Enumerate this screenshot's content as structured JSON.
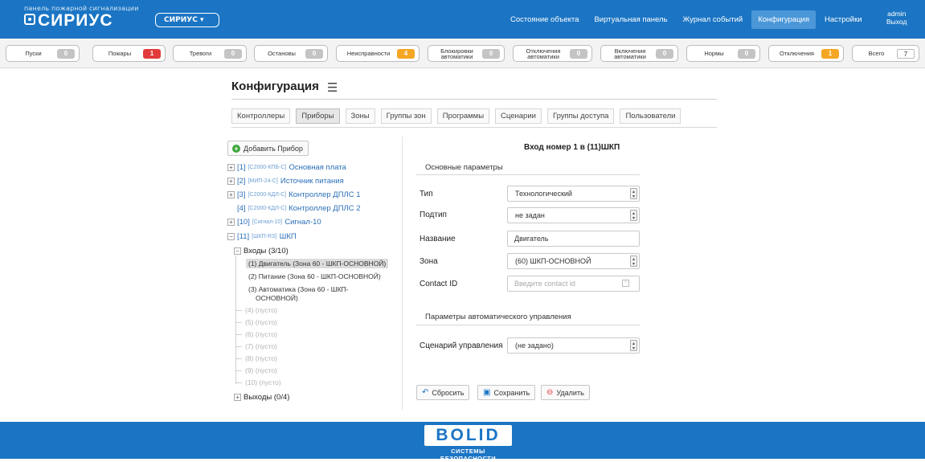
{
  "header": {
    "brand_subtitle": "панель пожарной сигнализации",
    "brand_name": "СИРИУС",
    "system_select": "СИРИУС",
    "nav": [
      {
        "label": "Состояние объекта"
      },
      {
        "label": "Виртуальная панель"
      },
      {
        "label": "Журнал событий"
      },
      {
        "label": "Конфигурация"
      },
      {
        "label": "Настройки"
      }
    ],
    "user": {
      "name": "admin",
      "logout": "Выход"
    }
  },
  "status_bar": [
    {
      "label": "Пуски",
      "count": "0"
    },
    {
      "label": "Пожары",
      "count": "1"
    },
    {
      "label": "Тревоги",
      "count": "0"
    },
    {
      "label": "Остановы",
      "count": "0"
    },
    {
      "label": "Неисправности",
      "count": "4"
    },
    {
      "label": "Блокировки автоматики",
      "count": "0"
    },
    {
      "label": "Отключения автоматики",
      "count": "0"
    },
    {
      "label": "Включения автоматики",
      "count": "0"
    },
    {
      "label": "Нормы",
      "count": "0"
    },
    {
      "label": "Отключения",
      "count": "1"
    },
    {
      "label": "Всего",
      "count": "7"
    }
  ],
  "page": {
    "title": "Конфигурация",
    "tabs": [
      {
        "label": "Контроллеры"
      },
      {
        "label": "Приборы"
      },
      {
        "label": "Зоны"
      },
      {
        "label": "Группы зон"
      },
      {
        "label": "Программы"
      },
      {
        "label": "Сценарии"
      },
      {
        "label": "Группы доступа"
      },
      {
        "label": "Пользователи"
      }
    ]
  },
  "tree": {
    "add_label": "Добавить Прибор",
    "devices": [
      {
        "num": "[1]",
        "code": "[С2000-КПБ-С]",
        "name": "Основная плата"
      },
      {
        "num": "[2]",
        "code": "[МИП-24-С]",
        "name": "Источник питания"
      },
      {
        "num": "[3]",
        "code": "[С2000-КДЛ-С]",
        "name": "Контроллер ДПЛС 1"
      },
      {
        "num": "[4]",
        "code": "[С2000-КДЛ-С]",
        "name": "Контроллер ДПЛС 2"
      },
      {
        "num": "[10]",
        "code": "[Сигнал-10]",
        "name": "Сигнал-10"
      },
      {
        "num": "[11]",
        "code": "[ШКП-RS]",
        "name": "ШКП"
      }
    ],
    "inputs_group": "Входы (3/10)",
    "inputs": [
      {
        "label": "(1) Двигатель (Зона 60 - ШКП-ОСНОВНОЙ)"
      },
      {
        "label": "(2) Питание (Зона 60 - ШКП-ОСНОВНОЙ)"
      },
      {
        "label": "(3) Автоматика (Зона 60 - ШКП-"
      },
      {
        "label": "ОСНОВНОЙ)"
      }
    ],
    "empty_inputs": [
      "(4) (пусто)",
      "(5) (пусто)",
      "(6) (пусто)",
      "(7) (пусто)",
      "(8) (пусто)",
      "(9) (пусто)",
      "(10) (пусто)"
    ],
    "outputs_group": "Выходы (0/4)"
  },
  "form": {
    "title": "Вход номер 1 в (11)ШКП",
    "basic_section": "Основные параметры",
    "type_label": "Тип",
    "type_value": "Технологический",
    "subtype_label": "Подтип",
    "subtype_value": "не задан",
    "name_label": "Название",
    "name_value": "Двигатель",
    "zone_label": "Зона",
    "zone_value": "(60) ШКП-ОСНОВНОЙ",
    "contact_label": "Contact ID",
    "contact_placeholder": "Введите contact id",
    "auto_section": "Параметры автоматического управления",
    "scenario_label": "Сценарий управления",
    "scenario_value": "(не задано)",
    "reset_label": "Сбросить",
    "save_label": "Сохранить",
    "delete_label": "Удалить"
  },
  "footer": {
    "logo": "BOLID",
    "tagline": "СИСТЕМЫ БЕЗОПАСНОСТИ"
  },
  "colors": {
    "primary": "#1b75c4",
    "alarm": "#e23a3a",
    "warning": "#f5a623",
    "link": "#2b6fb8"
  }
}
